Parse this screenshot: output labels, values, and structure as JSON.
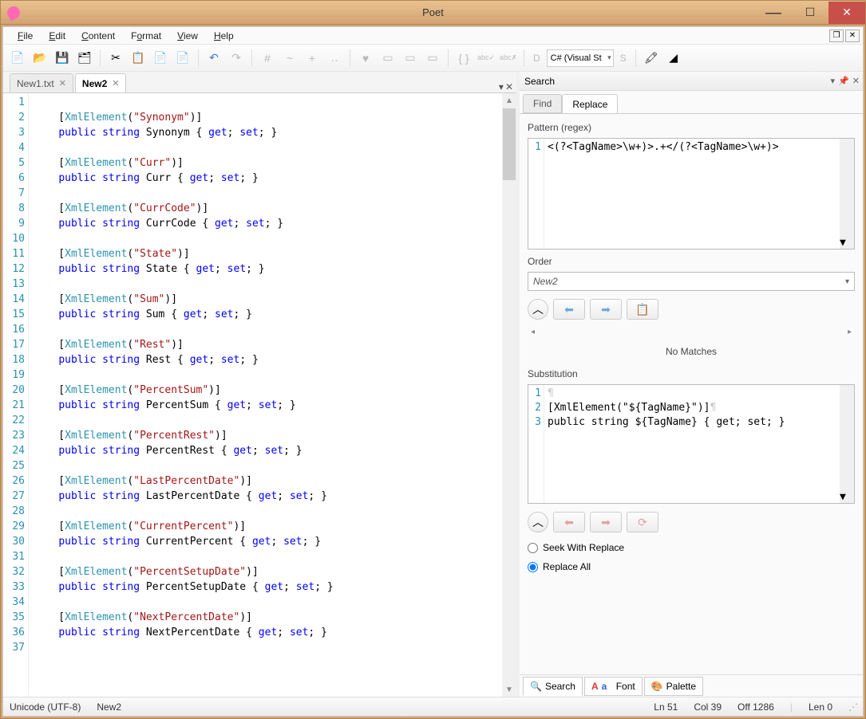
{
  "title": "Poet",
  "menu": {
    "file": "File",
    "edit": "Edit",
    "content": "Content",
    "format": "Format",
    "view": "View",
    "help": "Help"
  },
  "toolbar": {
    "lang_combo": "C# (Visual St",
    "lang_prefix": "D",
    "style_prefix": "S"
  },
  "tabs": {
    "tab1": "New1.txt",
    "tab2": "New2"
  },
  "code_lines": [
    "",
    "    [<span class='attr'>XmlElement</span>(<span class='str'>\"Synonym\"</span>)]",
    "    <span class='kw'>public</span> <span class='type'>string</span> Synonym { <span class='kw'>get</span>; <span class='kw'>set</span>; }",
    "",
    "    [<span class='attr'>XmlElement</span>(<span class='str'>\"Curr\"</span>)]",
    "    <span class='kw'>public</span> <span class='type'>string</span> Curr { <span class='kw'>get</span>; <span class='kw'>set</span>; }",
    "",
    "    [<span class='attr'>XmlElement</span>(<span class='str'>\"CurrCode\"</span>)]",
    "    <span class='kw'>public</span> <span class='type'>string</span> CurrCode { <span class='kw'>get</span>; <span class='kw'>set</span>; }",
    "",
    "    [<span class='attr'>XmlElement</span>(<span class='str'>\"State\"</span>)]",
    "    <span class='kw'>public</span> <span class='type'>string</span> State { <span class='kw'>get</span>; <span class='kw'>set</span>; }",
    "",
    "    [<span class='attr'>XmlElement</span>(<span class='str'>\"Sum\"</span>)]",
    "    <span class='kw'>public</span> <span class='type'>string</span> Sum { <span class='kw'>get</span>; <span class='kw'>set</span>; }",
    "",
    "    [<span class='attr'>XmlElement</span>(<span class='str'>\"Rest\"</span>)]",
    "    <span class='kw'>public</span> <span class='type'>string</span> Rest { <span class='kw'>get</span>; <span class='kw'>set</span>; }",
    "",
    "    [<span class='attr'>XmlElement</span>(<span class='str'>\"PercentSum\"</span>)]",
    "    <span class='kw'>public</span> <span class='type'>string</span> PercentSum { <span class='kw'>get</span>; <span class='kw'>set</span>; }",
    "",
    "    [<span class='attr'>XmlElement</span>(<span class='str'>\"PercentRest\"</span>)]",
    "    <span class='kw'>public</span> <span class='type'>string</span> PercentRest { <span class='kw'>get</span>; <span class='kw'>set</span>; }",
    "",
    "    [<span class='attr'>XmlElement</span>(<span class='str'>\"LastPercentDate\"</span>)]",
    "    <span class='kw'>public</span> <span class='type'>string</span> LastPercentDate { <span class='kw'>get</span>; <span class='kw'>set</span>; }",
    "",
    "    [<span class='attr'>XmlElement</span>(<span class='str'>\"CurrentPercent\"</span>)]",
    "    <span class='kw'>public</span> <span class='type'>string</span> CurrentPercent { <span class='kw'>get</span>; <span class='kw'>set</span>; }",
    "",
    "    [<span class='attr'>XmlElement</span>(<span class='str'>\"PercentSetupDate\"</span>)]",
    "    <span class='kw'>public</span> <span class='type'>string</span> PercentSetupDate { <span class='kw'>get</span>; <span class='kw'>set</span>; }",
    "",
    "    [<span class='attr'>XmlElement</span>(<span class='str'>\"NextPercentDate\"</span>)]",
    "    <span class='kw'>public</span> <span class='type'>string</span> NextPercentDate { <span class='kw'>get</span>; <span class='kw'>set</span>; }",
    ""
  ],
  "search_panel": {
    "title": "Search",
    "tab_find": "Find",
    "tab_replace": "Replace",
    "pattern_label": "Pattern (regex)",
    "pattern_value": "<(?<TagName>\\w+)>.+</(?<TagName>\\w+)>",
    "order_label": "Order",
    "order_value": "New2",
    "no_matches": "No Matches",
    "substitution_label": "Substitution",
    "sub_lines": [
      "",
      "[XmlElement(\"${TagName}\")]",
      "public string ${TagName} { get; set; }"
    ],
    "seek_with_replace": "Seek With Replace",
    "replace_all": "Replace All"
  },
  "bottom_tabs": {
    "search": "Search",
    "font": "Font",
    "palette": "Palette"
  },
  "status": {
    "encoding": "Unicode (UTF-8)",
    "file": "New2",
    "ln": "Ln 51",
    "col": "Col 39",
    "off": "Off 1286",
    "len": "Len 0"
  }
}
